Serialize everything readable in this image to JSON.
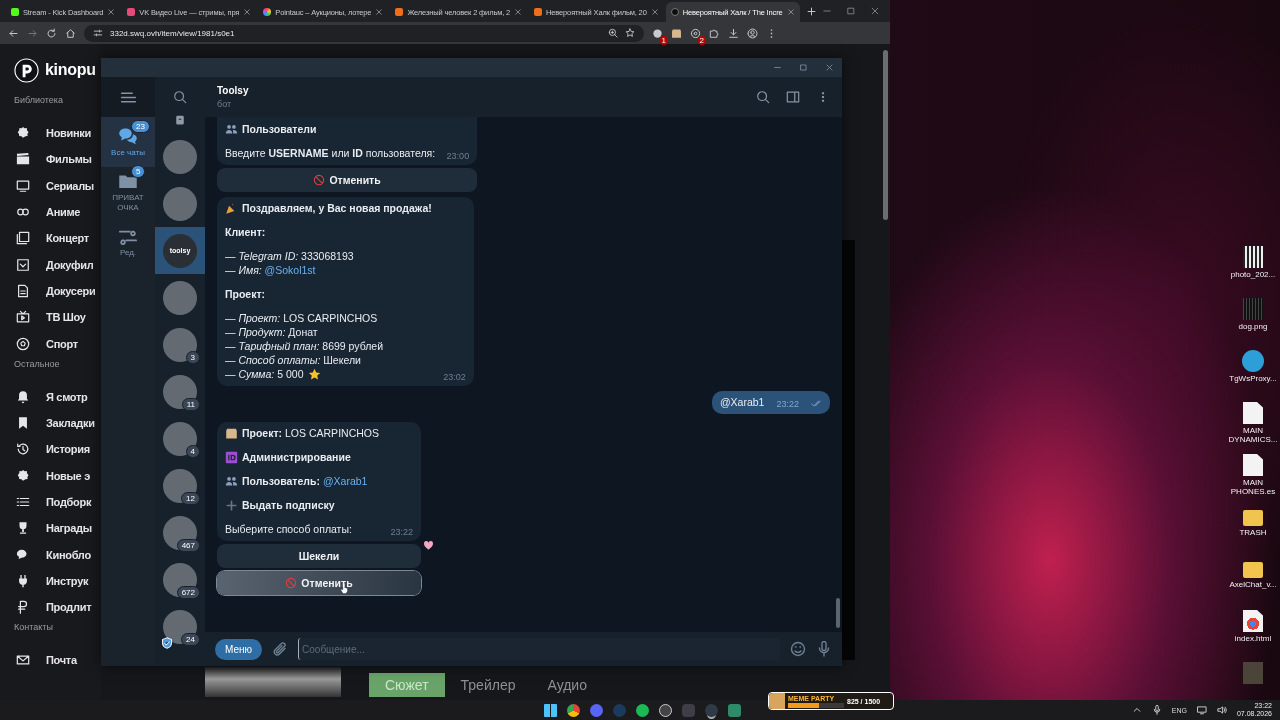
{
  "browser": {
    "tabs": [
      {
        "title": "Stream - Kick Dashboard",
        "kind": "kick",
        "selected": false
      },
      {
        "title": "VK Видео Live — стримы, пря",
        "kind": "vk",
        "selected": false
      },
      {
        "title": "Pointauc – Аукционы, лотере",
        "kind": "pointauc",
        "selected": false
      },
      {
        "title": "Железный человек 2 фильм, 2",
        "kind": "kp",
        "selected": false
      },
      {
        "title": "Невероятный Халк фильм, 20",
        "kind": "kp",
        "selected": false
      },
      {
        "title": "Невероятный Халк / The Incre",
        "kind": "site",
        "selected": true
      }
    ],
    "url": "332d.swq.ovh/item/view/1981/s0e1",
    "extensions": [
      {
        "kind": "coin",
        "badge": "1"
      },
      {
        "kind": "box"
      },
      {
        "kind": "record",
        "badge": "2"
      },
      {
        "kind": "puzzle"
      }
    ]
  },
  "kinopoisk": {
    "logo": "kinopu",
    "sections": [
      {
        "title": "Библиотека",
        "items": [
          {
            "label": "Новинки",
            "kind": "burst"
          },
          {
            "label": "Фильмы",
            "kind": "clapper"
          },
          {
            "label": "Сериалы",
            "kind": "monitor"
          },
          {
            "label": "Аниме",
            "kind": "rings"
          },
          {
            "label": "Концерт",
            "kind": "album"
          },
          {
            "label": "Докуфил",
            "kind": "dlbox"
          },
          {
            "label": "Докусери",
            "kind": "doc"
          },
          {
            "label": "ТВ Шоу",
            "kind": "tv"
          },
          {
            "label": "Спорт",
            "kind": "ball"
          }
        ]
      },
      {
        "title": "Остальное",
        "items": [
          {
            "label": "Я смотр",
            "kind": "bell"
          },
          {
            "label": "Закладки",
            "kind": "bookmark"
          },
          {
            "label": "История",
            "kind": "history"
          },
          {
            "label": "Новые э",
            "kind": "burst"
          },
          {
            "label": "Подборк",
            "kind": "list"
          },
          {
            "label": "Награды",
            "kind": "trophy"
          },
          {
            "label": "Кинобло",
            "kind": "chat"
          },
          {
            "label": "Инструк",
            "kind": "plug"
          },
          {
            "label": "Продлит",
            "kind": "ruble"
          }
        ]
      },
      {
        "title": "Контакты",
        "items": [
          {
            "label": "Почта",
            "kind": "mail"
          }
        ]
      }
    ],
    "detail_tabs": [
      {
        "label": "Сюжет",
        "selected": true
      },
      {
        "label": "Трейлер",
        "selected": false
      },
      {
        "label": "Аудио",
        "selected": false
      }
    ]
  },
  "telegram": {
    "folders": [
      {
        "label": "Все чаты",
        "badge": "23",
        "kind": "chats",
        "selected": true
      },
      {
        "label": "ПРИВАТ ОЧКА",
        "badge": "5",
        "kind": "folder",
        "selected": false
      },
      {
        "label": "Ред.",
        "kind": "sliders",
        "selected": false
      }
    ],
    "chats": [
      {
        "kind": "photo",
        "selected": false,
        "verified": false
      },
      {
        "kind": "photo",
        "selected": false,
        "verified": false
      },
      {
        "kind": "logo",
        "text": "toolsy",
        "selected": true,
        "verified": false
      },
      {
        "kind": "photo",
        "selected": false,
        "verified": false
      },
      {
        "kind": "photo",
        "badge": "3",
        "selected": false,
        "verified": false
      },
      {
        "kind": "photo",
        "badge": "11",
        "selected": false,
        "verified": false
      },
      {
        "kind": "photo",
        "badge": "4",
        "selected": false,
        "verified": false
      },
      {
        "kind": "photo",
        "badge": "12",
        "selected": false,
        "verified": false
      },
      {
        "kind": "photo",
        "badge": "467",
        "selected": false,
        "verified": false
      },
      {
        "kind": "photo",
        "badge": "672",
        "selected": false,
        "verified": false
      },
      {
        "kind": "photo",
        "badge": "24",
        "selected": false,
        "verified": true
      }
    ],
    "chat": {
      "title": "Toolsy",
      "status": "бот"
    },
    "messages": [
      {
        "outgoing": false,
        "paragraphs": [
          [
            {
              "kind": "people",
              "text": "Пользователи",
              "bold": true
            }
          ],
          [
            {
              "kind": "plain",
              "text": "Введите **USERNAME** или **ID** пользователя:",
              "bold": false
            }
          ]
        ],
        "time": "23:00",
        "buttons": [
          {
            "label": "Отменить",
            "kind": "cancel",
            "hovered": false
          }
        ]
      },
      {
        "outgoing": false,
        "paragraphs": [
          [
            {
              "kind": "party",
              "text": "Поздравляем, у Вас новая продажа!",
              "bold": true
            }
          ],
          [
            {
              "kind": "plain",
              "text": "Клиент:",
              "bold": true
            }
          ],
          [
            {
              "kind": "plain",
              "text": "— *Telegram ID:* 333068193",
              "bold": false
            },
            {
              "kind": "plain",
              "text": "— *Имя:*",
              "link": "@Sokol1st",
              "bold": false
            }
          ],
          [
            {
              "kind": "plain",
              "text": "Проект:",
              "bold": true
            }
          ],
          [
            {
              "kind": "plain",
              "text": "— *Проект:* LOS CARPINCHOS",
              "bold": false
            },
            {
              "kind": "plain",
              "text": "— *Продукт:* Донат",
              "bold": false
            },
            {
              "kind": "plain",
              "text": "— *Тарифный план:* 8699 рублей",
              "bold": false
            },
            {
              "kind": "plain",
              "text": "— *Способ оплаты:* Шекели",
              "bold": false
            },
            {
              "kind": "star",
              "text": "— *Сумма:* 5 000",
              "bold": false
            }
          ]
        ],
        "time": "23:02"
      },
      {
        "outgoing": true,
        "paragraphs": [
          [
            {
              "kind": "plain",
              "text": "@Xarab1",
              "bold": false
            }
          ]
        ],
        "time": "23:22",
        "read": true
      },
      {
        "outgoing": false,
        "paragraphs": [
          [
            {
              "kind": "box",
              "text": "**Проект:** LOS CARPINCHOS",
              "bold": false
            }
          ],
          [
            {
              "kind": "id",
              "text": "Администрирование",
              "bold": true
            }
          ],
          [
            {
              "kind": "people",
              "text": "**Пользователь:**",
              "link": "@Xarab1",
              "bold": false
            }
          ],
          [
            {
              "kind": "plus",
              "text": "Выдать подписку",
              "bold": true
            }
          ],
          [
            {
              "kind": "plain",
              "text": "Выберите способ оплаты:",
              "bold": false
            }
          ]
        ],
        "time": "23:22",
        "reacted": true,
        "buttons": [
          {
            "label": "Шекели",
            "kind": "plain",
            "hovered": false
          },
          {
            "label": "Отменить",
            "kind": "cancel",
            "hovered": true
          }
        ]
      }
    ],
    "input": {
      "menu": "Меню",
      "placeholder": "Сообщение..."
    }
  },
  "desktop_icons": [
    {
      "label": "photo_202...",
      "kind": "qr"
    },
    {
      "label": "dog.png",
      "kind": "image"
    },
    {
      "label": "TgWsProxy...",
      "kind": "tg"
    },
    {
      "label": "MAIN DYNAMICS...",
      "kind": "file"
    },
    {
      "label": "MAIN PHONES.es",
      "kind": "file"
    },
    {
      "label": "TRASH",
      "kind": "folder"
    },
    {
      "label": "AxelChat_v...",
      "kind": "folder"
    },
    {
      "label": "index.html",
      "kind": "html"
    },
    {
      "kind": "archive"
    }
  ],
  "taskbar": {
    "apps": [
      {
        "kind": "start",
        "active": false
      },
      {
        "kind": "chrome",
        "active": false
      },
      {
        "kind": "discord",
        "active": false
      },
      {
        "kind": "steam",
        "active": false
      },
      {
        "kind": "spotify",
        "active": false
      },
      {
        "kind": "obs",
        "active": false
      },
      {
        "kind": "pill",
        "active": false
      },
      {
        "kind": "telegram",
        "active": true
      },
      {
        "kind": "swap",
        "active": false
      }
    ],
    "widget": {
      "title": "MEME PARTY",
      "reading": "825 / 1500",
      "level": 0.55
    },
    "language": "ENG",
    "time": "23:22",
    "date": "07.08.2026"
  }
}
